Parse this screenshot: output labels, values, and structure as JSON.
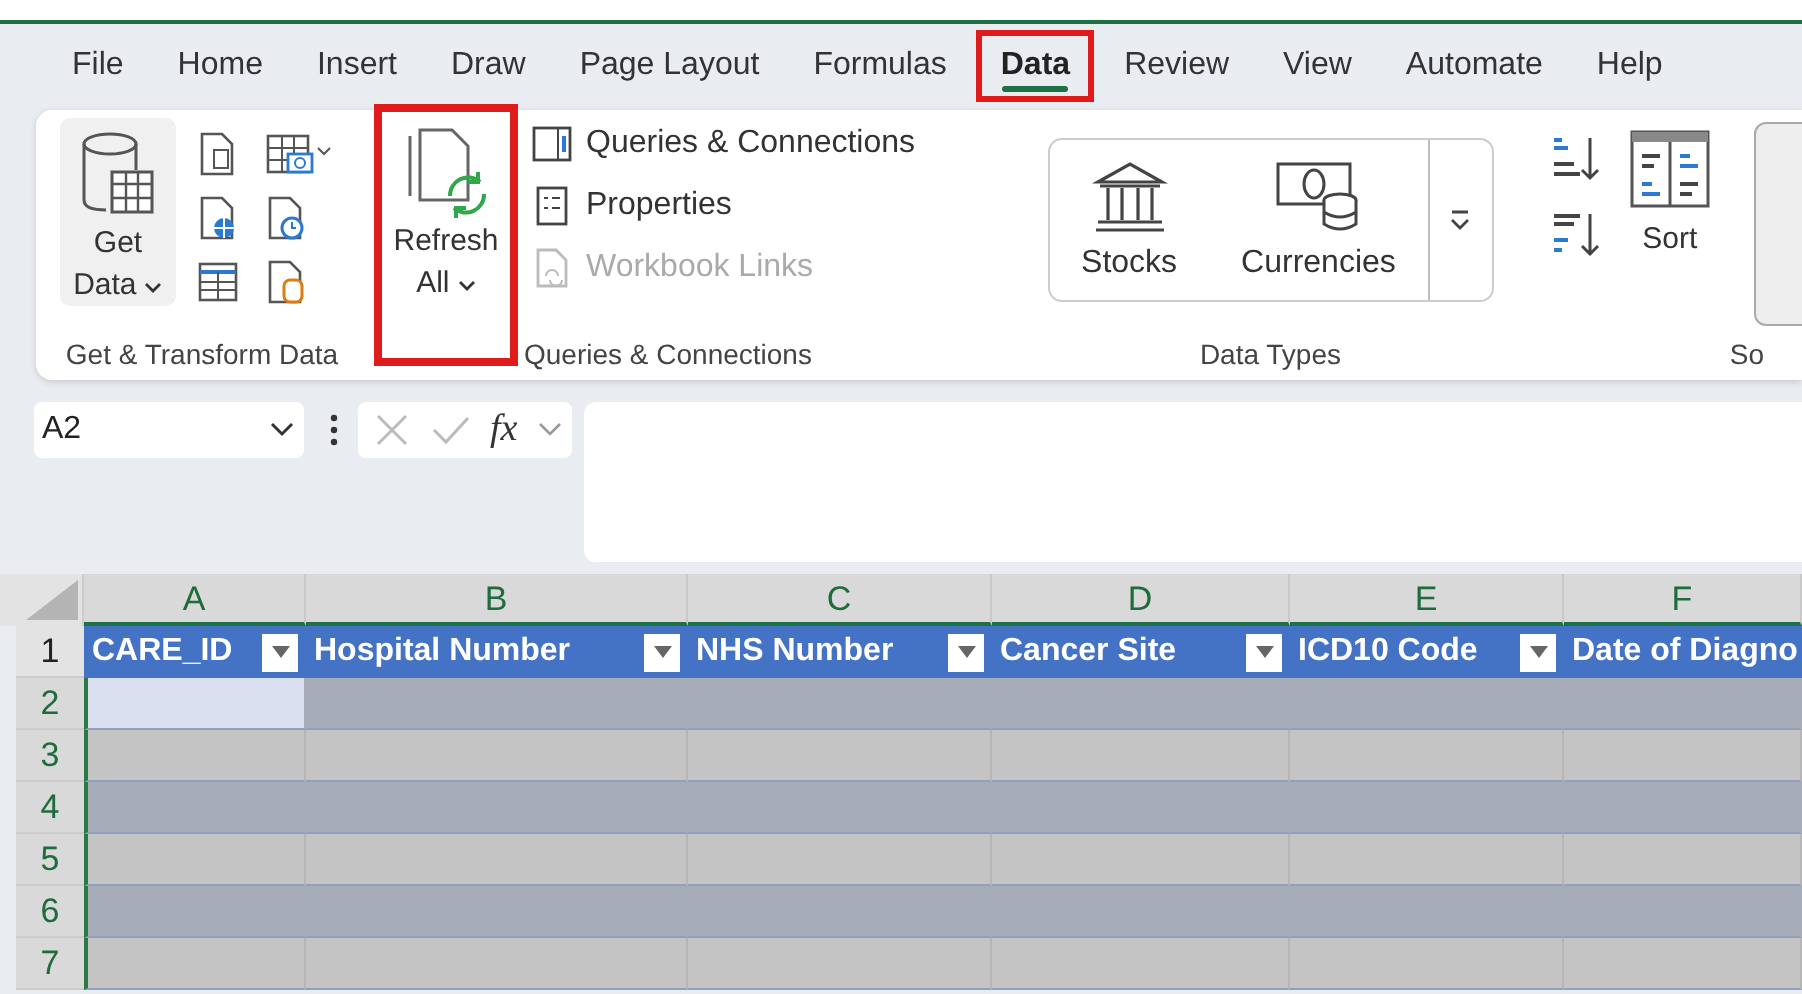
{
  "tabs": [
    {
      "label": "File",
      "selected": false,
      "highlighted": false
    },
    {
      "label": "Home",
      "selected": false,
      "highlighted": false
    },
    {
      "label": "Insert",
      "selected": false,
      "highlighted": false
    },
    {
      "label": "Draw",
      "selected": false,
      "highlighted": false
    },
    {
      "label": "Page Layout",
      "selected": false,
      "highlighted": false
    },
    {
      "label": "Formulas",
      "selected": false,
      "highlighted": false
    },
    {
      "label": "Data",
      "selected": true,
      "highlighted": true
    },
    {
      "label": "Review",
      "selected": false,
      "highlighted": false
    },
    {
      "label": "View",
      "selected": false,
      "highlighted": false
    },
    {
      "label": "Automate",
      "selected": false,
      "highlighted": false
    },
    {
      "label": "Help",
      "selected": false,
      "highlighted": false
    }
  ],
  "ribbon": {
    "get_transform": {
      "label": "Get & Transform Data",
      "button_lines": [
        "Get",
        "Data"
      ]
    },
    "refresh_all": {
      "lines": [
        "Refresh",
        "All"
      ],
      "highlighted": true
    },
    "queries": {
      "label": "Queries & Connections",
      "items": [
        {
          "kind": "queries",
          "label": "Queries & Connections",
          "disabled": false
        },
        {
          "kind": "properties",
          "label": "Properties",
          "disabled": false
        },
        {
          "kind": "links",
          "label": "Workbook Links",
          "disabled": true
        }
      ]
    },
    "data_types": {
      "label": "Data Types",
      "items": [
        {
          "kind": "stocks",
          "label": "Stocks"
        },
        {
          "kind": "currencies",
          "label": "Currencies"
        }
      ]
    },
    "sort_filter": {
      "label": "So",
      "sort_label": "Sort"
    }
  },
  "formula_bar": {
    "name_box": "A2",
    "function_label": "fx"
  },
  "sheet": {
    "columns": [
      "A",
      "B",
      "C",
      "D",
      "E",
      "F"
    ],
    "header_row": {
      "number": "1",
      "active": false,
      "cells": [
        "CARE_ID",
        "Hospital Number",
        "NHS Number",
        "Cancer Site",
        "ICD10 Code",
        "Date of Diagno"
      ]
    },
    "rows": [
      {
        "number": "2",
        "active": true,
        "shaded": true,
        "cells": [
          {
            "selected": true
          },
          {
            "selected": false
          },
          {
            "selected": false
          },
          {
            "selected": false
          },
          {
            "selected": false
          },
          {
            "selected": false
          }
        ]
      },
      {
        "number": "3",
        "active": true,
        "shaded": false,
        "cells": [
          {
            "selected": false
          },
          {
            "selected": false
          },
          {
            "selected": false
          },
          {
            "selected": false
          },
          {
            "selected": false
          },
          {
            "selected": false
          }
        ]
      },
      {
        "number": "4",
        "active": true,
        "shaded": true,
        "cells": [
          {
            "selected": false
          },
          {
            "selected": false
          },
          {
            "selected": false
          },
          {
            "selected": false
          },
          {
            "selected": false
          },
          {
            "selected": false
          }
        ]
      },
      {
        "number": "5",
        "active": true,
        "shaded": false,
        "cells": [
          {
            "selected": false
          },
          {
            "selected": false
          },
          {
            "selected": false
          },
          {
            "selected": false
          },
          {
            "selected": false
          },
          {
            "selected": false
          }
        ]
      },
      {
        "number": "6",
        "active": true,
        "shaded": true,
        "cells": [
          {
            "selected": false
          },
          {
            "selected": false
          },
          {
            "selected": false
          },
          {
            "selected": false
          },
          {
            "selected": false
          },
          {
            "selected": false
          }
        ]
      },
      {
        "number": "7",
        "active": true,
        "shaded": false,
        "cells": [
          {
            "selected": false
          },
          {
            "selected": false
          },
          {
            "selected": false
          },
          {
            "selected": false
          },
          {
            "selected": false
          },
          {
            "selected": false
          }
        ]
      }
    ]
  }
}
